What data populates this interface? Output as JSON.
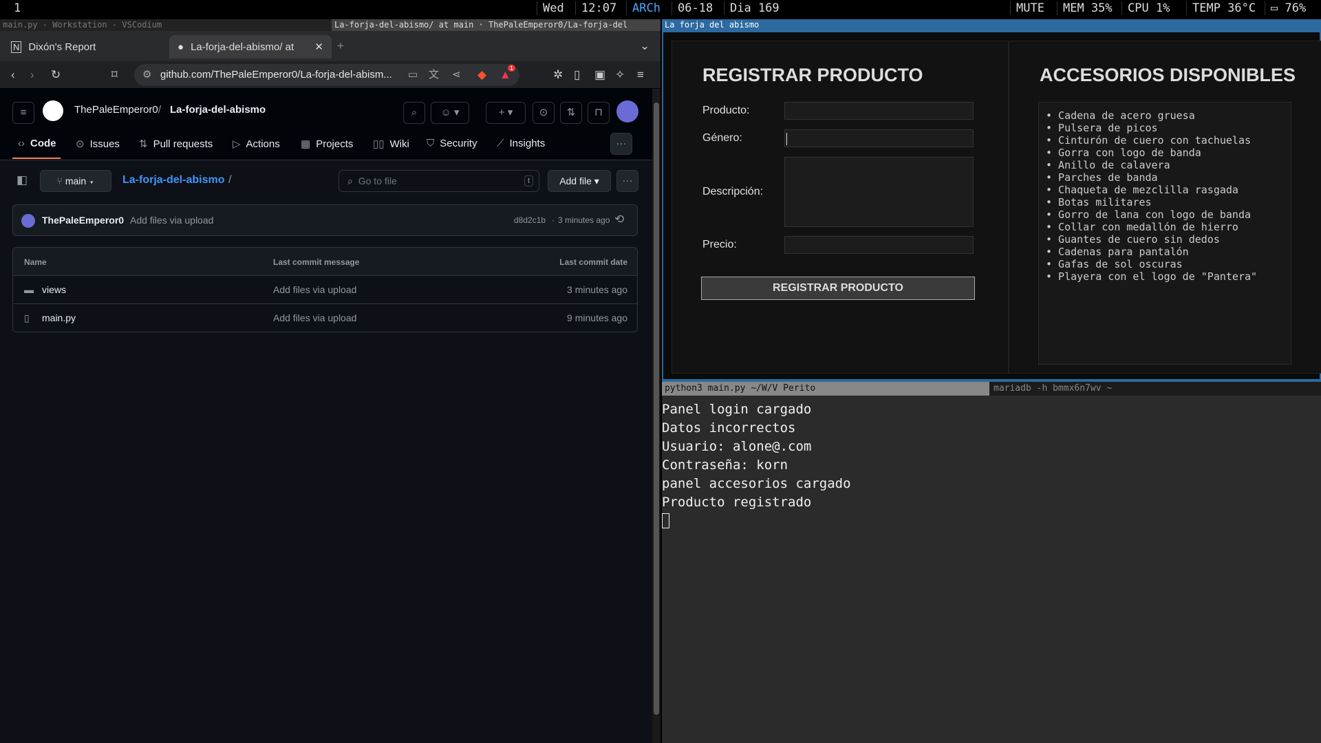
{
  "topbar": {
    "workspace": "1",
    "day": "Wed",
    "time": "12:07",
    "distro": "ARCh",
    "date": "06-18",
    "day_count": "Dia 169",
    "mute": "MUTE",
    "mem": "MEM 35%",
    "cpu": "CPU  1%",
    "temp": "TEMP 36°C",
    "battery": "76%"
  },
  "window_titles": {
    "left": "main.py - Workstation - VSCodium",
    "mid": "La-forja-del-abismo/ at main · ThePaleEmperor0/La-forja-del",
    "right": "La forja del abismo"
  },
  "browser": {
    "tabs": [
      {
        "label": "Dixón's Report"
      },
      {
        "label": "La-forja-del-abismo/ at"
      }
    ],
    "new_tab": "+",
    "url": "github.com/ThePaleEmperor0/La-forja-del-abism...",
    "notif_count": "1"
  },
  "github": {
    "owner": "ThePaleEmperor0",
    "separator": "/",
    "repo": "La-forja-del-abismo",
    "nav": [
      "Code",
      "Issues",
      "Pull requests",
      "Actions",
      "Projects",
      "Wiki",
      "Security",
      "Insights"
    ],
    "branch": "main",
    "path_repo": "La-forja-del-abismo",
    "path_sep": "/",
    "goto_placeholder": "Go to file",
    "goto_key": "t",
    "add_file": "Add file",
    "commit": {
      "author": "ThePaleEmperor0",
      "message": "Add files via upload",
      "hash": "d8d2c1b",
      "time": "3 minutes ago"
    },
    "table": {
      "headers": [
        "Name",
        "Last commit message",
        "Last commit date"
      ],
      "rows": [
        {
          "name": "views",
          "type": "folder",
          "message": "Add files via upload",
          "date": "3 minutes ago"
        },
        {
          "name": "main.py",
          "type": "file",
          "message": "Add files via upload",
          "date": "9 minutes ago"
        }
      ]
    }
  },
  "app": {
    "form_title": "REGISTRAR PRODUCTO",
    "labels": {
      "producto": "Producto:",
      "genero": "Género:",
      "descripcion": "Descripción:",
      "precio": "Precio:"
    },
    "submit": "REGISTRAR PRODUCTO",
    "acc_title": "ACCESORIOS DISPONIBLES",
    "accessories": [
      "Cadena de acero gruesa",
      "Pulsera de picos",
      "Cinturón de cuero con tachuelas",
      "Gorra con logo de banda",
      "Anillo de calavera",
      "Parches de banda",
      "Chaqueta de mezclilla rasgada",
      "Botas militares",
      "Gorro de lana con logo de banda",
      "Collar con medallón de hierro",
      "Guantes de cuero sin dedos",
      "Cadenas para pantalón",
      "Gafas de sol oscuras",
      "Playera con el logo de \"Pantera\""
    ]
  },
  "terminal": {
    "tab1": "python3 main.py ~/W/V Perito",
    "tab2": "mariadb -h bmmx6n7wv ~",
    "lines": [
      "Panel login cargado",
      "Datos incorrectos",
      "Usuario: alone@.com",
      "Contraseña: korn",
      "panel accesorios cargado",
      "Producto registrado"
    ]
  }
}
